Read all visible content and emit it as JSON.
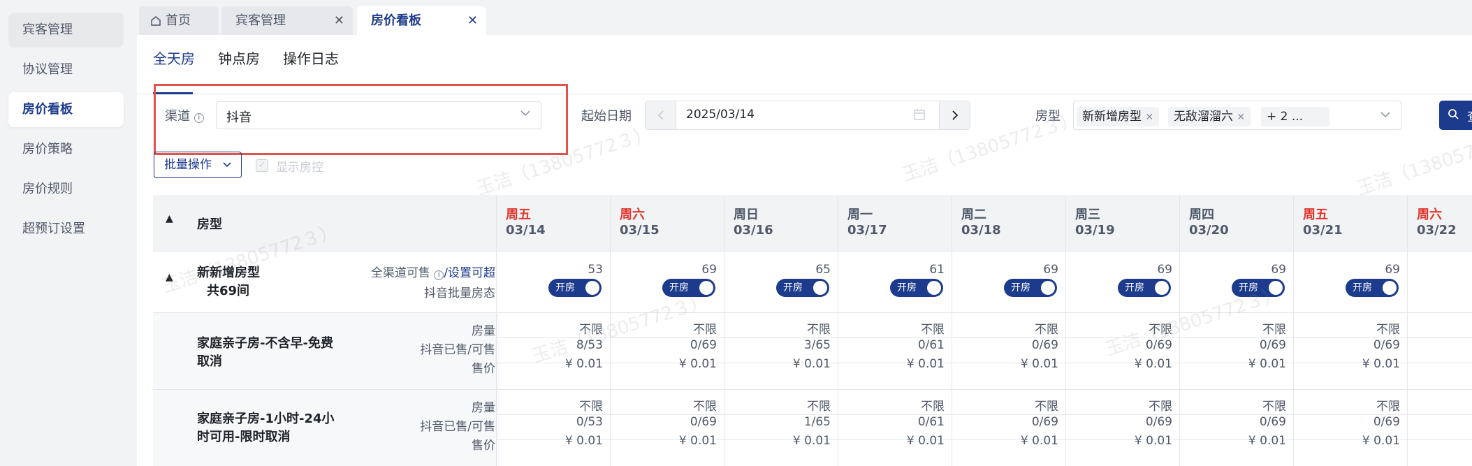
{
  "sidebar": {
    "items": [
      {
        "label": "宾客管理"
      },
      {
        "label": "协议管理"
      },
      {
        "label": "房价看板"
      },
      {
        "label": "房价策略"
      },
      {
        "label": "房价规则"
      },
      {
        "label": "超预订设置"
      }
    ]
  },
  "tabs": [
    {
      "label": "首页",
      "icon": "home-icon"
    },
    {
      "label": "宾客管理",
      "close": "✕"
    },
    {
      "label": "房价看板",
      "close": "✕"
    }
  ],
  "subtabs": [
    "全天房",
    "钟点房",
    "操作日志"
  ],
  "filters": {
    "channel_label": "渠道",
    "channel_value": "抖音",
    "start_date_label": "起始日期",
    "start_date_value": "2025/03/14",
    "room_type_label": "房型",
    "room_type_tags": [
      "新新增房型",
      "无敌溜溜六"
    ],
    "room_type_more": "+ 2 ...",
    "query_label": "查"
  },
  "toolbar": {
    "batch_label": "批量操作",
    "show_control_label": "显示房控"
  },
  "grid": {
    "room_type_header": "房型",
    "days": [
      {
        "name": "周五",
        "date": "03/14",
        "weekend": true
      },
      {
        "name": "周六",
        "date": "03/15",
        "weekend": true
      },
      {
        "name": "周日",
        "date": "03/16",
        "weekend": false
      },
      {
        "name": "周一",
        "date": "03/17",
        "weekend": false
      },
      {
        "name": "周二",
        "date": "03/18",
        "weekend": false
      },
      {
        "name": "周三",
        "date": "03/19",
        "weekend": false
      },
      {
        "name": "周四",
        "date": "03/20",
        "weekend": false
      },
      {
        "name": "周五",
        "date": "03/21",
        "weekend": true
      },
      {
        "name": "周六",
        "date": "03/22",
        "weekend": true
      }
    ],
    "room_group": {
      "name": "新新增房型",
      "count": "共69间",
      "all_channel_label": "全渠道可售",
      "set_oversell_label": "/设置可超",
      "batch_status_label": "抖音批量房态",
      "availability": [
        "53",
        "69",
        "65",
        "61",
        "69",
        "69",
        "69",
        "69",
        ""
      ],
      "toggle_label": "开房"
    },
    "row_labels": {
      "quota": "房量",
      "sold": "抖音已售/可售",
      "price": "售价"
    },
    "products": [
      {
        "name": "家庭亲子房-不含早-免费取消",
        "quota": [
          "不限",
          "不限",
          "不限",
          "不限",
          "不限",
          "不限",
          "不限",
          "不限",
          ""
        ],
        "sold": [
          "8/53",
          "0/69",
          "3/65",
          "0/61",
          "0/69",
          "0/69",
          "0/69",
          "0/69",
          ""
        ],
        "price": [
          "¥ 0.01",
          "¥ 0.01",
          "¥ 0.01",
          "¥ 0.01",
          "¥ 0.01",
          "¥ 0.01",
          "¥ 0.01",
          "¥ 0.01",
          ""
        ]
      },
      {
        "name": "家庭亲子房-1小时-24小时可用-限时取消",
        "quota": [
          "不限",
          "不限",
          "不限",
          "不限",
          "不限",
          "不限",
          "不限",
          "不限",
          ""
        ],
        "sold": [
          "0/53",
          "0/69",
          "1/65",
          "0/61",
          "0/69",
          "0/69",
          "0/69",
          "0/69",
          ""
        ],
        "price": [
          "¥ 0.01",
          "¥ 0.01",
          "¥ 0.01",
          "¥ 0.01",
          "¥ 0.01",
          "¥ 0.01",
          "¥ 0.01",
          "¥ 0.01",
          ""
        ]
      }
    ]
  },
  "watermark": "玉洁（13805772３）",
  "colors": {
    "accent": "#1d3b8c",
    "weekend": "#e0352b",
    "highlight_frame": "#e0524a"
  }
}
